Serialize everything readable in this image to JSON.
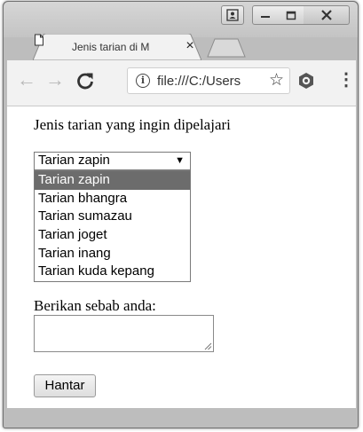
{
  "window": {
    "controls": {
      "user_icon": "user-icon",
      "minimize_icon": "minimize-icon",
      "maximize_icon": "maximize-icon",
      "close_icon": "close-icon"
    }
  },
  "tab": {
    "title": "Jenis tarian di M",
    "close_symbol": "×",
    "icon": "page-icon"
  },
  "toolbar": {
    "back_icon": "←",
    "forward_icon": "→",
    "reload_icon": "C",
    "url": "file:///C:/Users",
    "star_icon": "☆",
    "menu_icon": "⋮"
  },
  "page": {
    "heading": "Jenis tarian yang ingin dipelajari",
    "select": {
      "value": "Tarian zapin",
      "caret": "▼",
      "options": [
        "Tarian zapin",
        "Tarian bhangra",
        "Tarian sumazau",
        "Tarian joget",
        "Tarian inang",
        "Tarian kuda kepang"
      ],
      "highlighted_index": 0
    },
    "reason_label": "Berikan sebab anda:",
    "submit_label": "Hantar"
  },
  "colors": {
    "highlight": "#6c6c6c",
    "frame": "#bdbdbd"
  }
}
